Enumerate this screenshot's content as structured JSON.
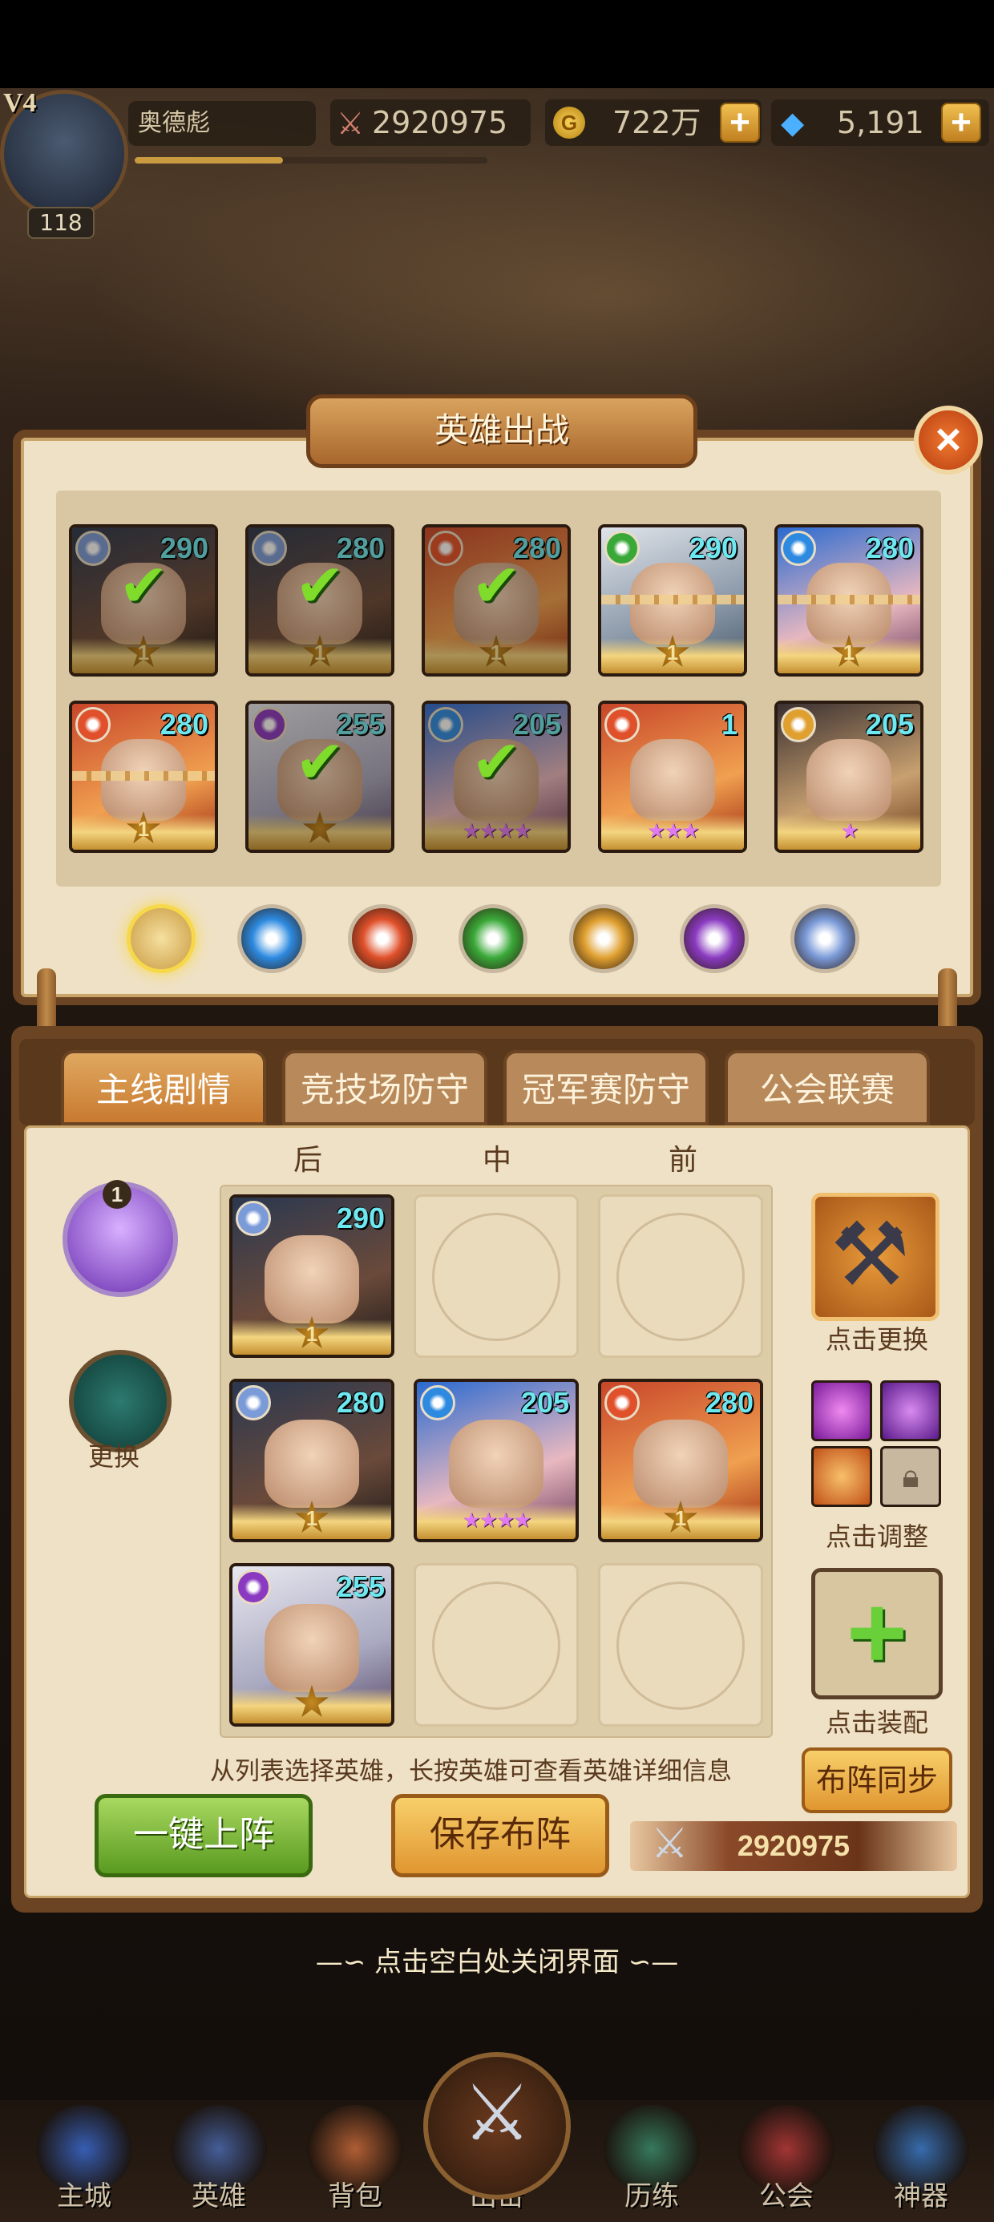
{
  "player": {
    "vip": "V4",
    "level": "118",
    "name": "奥德彪",
    "exp_fraction": 0.42
  },
  "resources": {
    "power": "2920975",
    "gold": "722万",
    "gold_symbol": "G",
    "gems": "5,191",
    "plus": "+"
  },
  "panel": {
    "title": "英雄出战",
    "close": "×"
  },
  "hero_cards": [
    {
      "level": "290",
      "element": "wind",
      "deployed": true,
      "star": "1",
      "locked": false
    },
    {
      "level": "280",
      "element": "wind",
      "deployed": true,
      "star": "1",
      "locked": false
    },
    {
      "level": "280",
      "element": "fire",
      "deployed": true,
      "star": "1",
      "locked": false
    },
    {
      "level": "290",
      "element": "nature",
      "deployed": false,
      "star": "1",
      "locked": true
    },
    {
      "level": "280",
      "element": "water",
      "deployed": false,
      "star": "1",
      "locked": true
    },
    {
      "level": "280",
      "element": "fire",
      "deployed": false,
      "star": "1",
      "locked": true
    },
    {
      "level": "255",
      "element": "dark",
      "deployed": true,
      "star": "",
      "locked": false
    },
    {
      "level": "205",
      "element": "water",
      "deployed": true,
      "stars": "★★★★",
      "locked": false
    },
    {
      "level": "1",
      "element": "fire",
      "deployed": false,
      "stars": "★★★",
      "locked": false
    },
    {
      "level": "205",
      "element": "light",
      "deployed": false,
      "stars": "★",
      "locked": false
    }
  ],
  "element_filters": [
    "all",
    "water",
    "fire",
    "nature",
    "light",
    "dark",
    "wind"
  ],
  "tabs": [
    "主线剧情",
    "竞技场防守",
    "冠军赛防守",
    "公会联赛"
  ],
  "columns": {
    "back": "后",
    "middle": "中",
    "front": "前"
  },
  "formation": [
    {
      "slot": "back-1",
      "level": "290",
      "element": "wind",
      "star": "1"
    },
    {
      "slot": "back-2",
      "level": "280",
      "element": "wind",
      "star": "1"
    },
    {
      "slot": "middle-2",
      "level": "205",
      "element": "water",
      "stars": "★★★★"
    },
    {
      "slot": "front-2",
      "level": "280",
      "element": "fire",
      "star": "1"
    },
    {
      "slot": "back-3",
      "level": "255",
      "element": "dark",
      "star": ""
    }
  ],
  "side": {
    "pet_badge": "1",
    "change_label": "更换",
    "weapon_label": "点击更换",
    "skills_label": "点击调整",
    "equip_label": "点击装配",
    "equip_plus": "+"
  },
  "hint": "从列表选择英雄，长按英雄可查看英雄详细信息",
  "buttons": {
    "sync": "布阵同步",
    "auto": "一键上阵",
    "save": "保存布阵"
  },
  "team_power": "2920975",
  "close_hint": "—∽ 点击空白处关闭界面 ∽—",
  "nav": [
    {
      "label": "主城",
      "icon": "castle-icon"
    },
    {
      "label": "英雄",
      "icon": "helmet-icon"
    },
    {
      "label": "背包",
      "icon": "backpack-icon"
    },
    {
      "label": "出击",
      "icon": "crossed-swords-icon"
    },
    {
      "label": "历练",
      "icon": "training-icon"
    },
    {
      "label": "公会",
      "icon": "guild-icon"
    },
    {
      "label": "神器",
      "icon": "artifact-icon"
    }
  ],
  "colors": {
    "water": "#2d8ae0",
    "fire": "#e0502a",
    "nature": "#3aa838",
    "light": "#e0a030",
    "dark": "#8a3ac0",
    "wind": "#7a9ad8",
    "accent": "#c87a30"
  }
}
